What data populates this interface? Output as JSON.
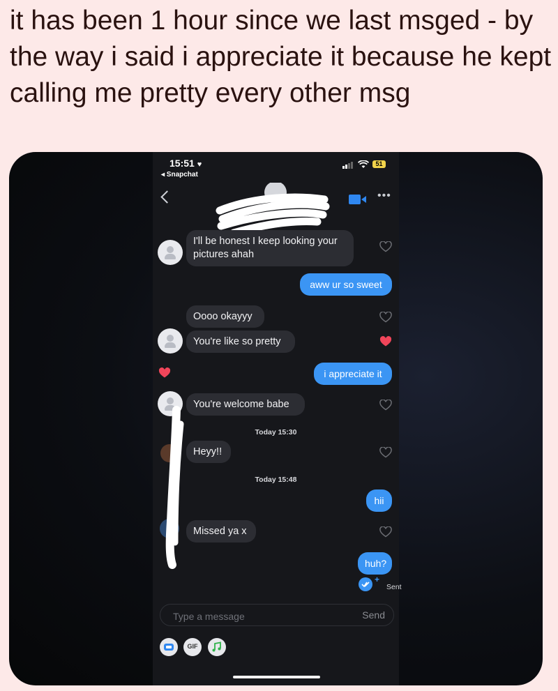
{
  "caption": "it has been 1 hour since we last msged - by the way i said i appreciate it because he kept calling me pretty every other msg",
  "status_bar": {
    "time": "15:51",
    "back_app": "◂ Snapchat",
    "battery": "51"
  },
  "messages": {
    "m1": "I'll be honest I keep looking your pictures ahah",
    "m2": "aww ur so sweet",
    "m3": "Oooo okayyy",
    "m4": "You're like so pretty",
    "m5": "i appreciate it",
    "m6": "You're welcome babe",
    "sep1": "Today 15:30",
    "m7": "Heyy!!",
    "sep2": "Today 15:48",
    "m8": "hii",
    "m9": "Missed ya x",
    "m10": "huh?"
  },
  "sent_status": "Sent",
  "composer": {
    "placeholder": "Type a message",
    "send_label": "Send"
  },
  "toolbar": {
    "gif_label": "GIF"
  },
  "colors": {
    "outgoing_bubble": "#3b95f4",
    "incoming_bubble": "#2c2d33",
    "heart": "#f0455a",
    "background": "#fde9e8"
  },
  "icons": [
    "chevron-left-icon",
    "video-camera-icon",
    "more-icon",
    "heart-icon",
    "sticker-icon",
    "music-icon"
  ]
}
